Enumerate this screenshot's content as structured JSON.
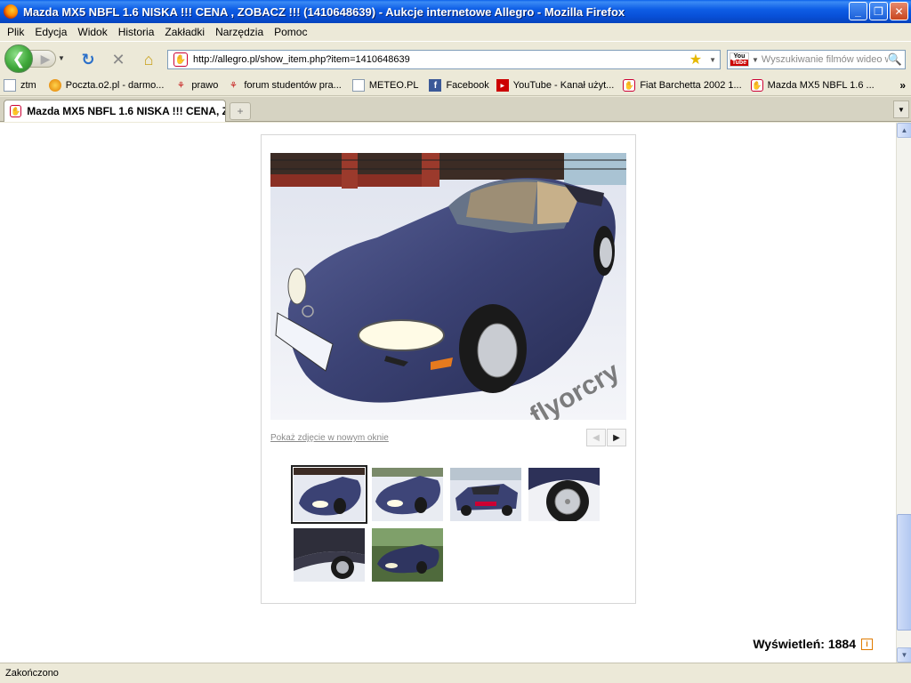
{
  "window": {
    "title": "Mazda MX5 NBFL 1.6 NISKA !!! CENA , ZOBACZ !!! (1410648639) - Aukcje internetowe Allegro - Mozilla Firefox",
    "minimize": "_",
    "maximize": "❐",
    "close": "✕"
  },
  "menu": {
    "plik": "Plik",
    "edycja": "Edycja",
    "widok": "Widok",
    "historia": "Historia",
    "zakladki": "Zakładki",
    "narzedzia": "Narzędzia",
    "pomoc": "Pomoc"
  },
  "nav": {
    "url": "http://allegro.pl/show_item.php?item=1410648639",
    "search_placeholder": "Wyszukiwanie filmów wideo w",
    "search_engine_top": "You",
    "search_engine_bottom": "Tube"
  },
  "bookmarks": [
    {
      "label": "ztm",
      "icon": "page-icon"
    },
    {
      "label": "Poczta.o2.pl - darmo...",
      "icon": "o2-icon"
    },
    {
      "label": "prawo",
      "icon": "red-figure-icon"
    },
    {
      "label": "forum studentów pra...",
      "icon": "red-figure-icon"
    },
    {
      "label": "METEO.PL",
      "icon": "page-icon"
    },
    {
      "label": "Facebook",
      "icon": "facebook-icon"
    },
    {
      "label": "YouTube - Kanał użyt...",
      "icon": "youtube-icon"
    },
    {
      "label": "Fiat Barchetta 2002 1...",
      "icon": "allegro-icon"
    },
    {
      "label": "Mazda MX5 NBFL 1.6 ...",
      "icon": "allegro-icon"
    }
  ],
  "tab": {
    "label": "Mazda MX5 NBFL 1.6 NISKA !!! CENA, Z..."
  },
  "gallery": {
    "watermark": "flyorcry",
    "open_link": "Pokaż zdjęcie w nowym oknie",
    "thumb_count": 6,
    "selected_thumb": 1
  },
  "views": {
    "label": "Wyświetleń: 1884"
  },
  "status": {
    "text": "Zakończono"
  },
  "colors": {
    "titlebar": "#0a5fe9",
    "car_body": "#3e4578",
    "snow": "#eef0f6"
  }
}
